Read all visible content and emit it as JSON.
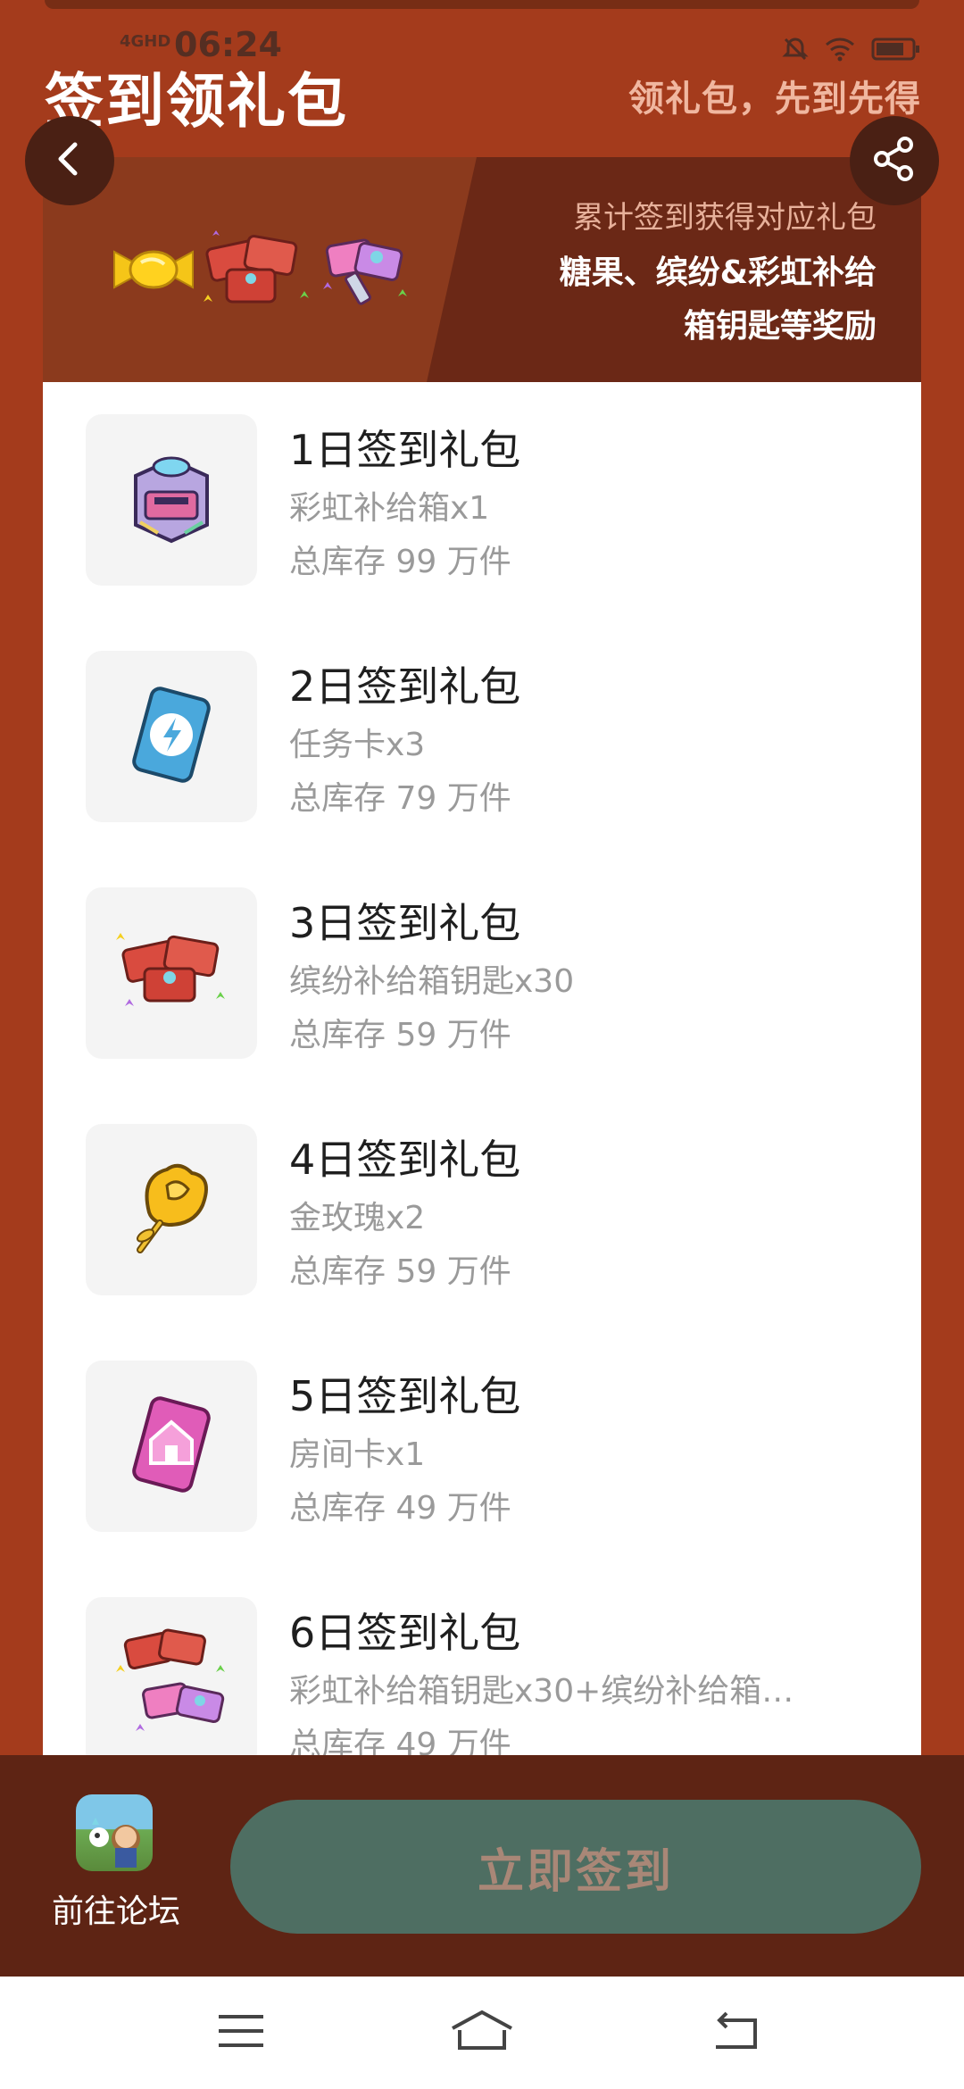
{
  "status_bar": {
    "time": "06:24",
    "network": "4GHD"
  },
  "header": {
    "title": "签到领礼包",
    "slogan": "领礼包，先到先得"
  },
  "banner": {
    "line1": "累计签到获得对应礼包",
    "line2": "糖果、缤纷&彩虹补给",
    "line3": "箱钥匙等奖励"
  },
  "gifts": [
    {
      "title": "1日签到礼包",
      "content": "彩虹补给箱x1",
      "stock": "总库存 99 万件",
      "icon": "rainbow-supply-box-icon"
    },
    {
      "title": "2日签到礼包",
      "content": "任务卡x3",
      "stock": "总库存 79 万件",
      "icon": "task-card-icon"
    },
    {
      "title": "3日签到礼包",
      "content": "缤纷补给箱钥匙x30",
      "stock": "总库存 59 万件",
      "icon": "colorful-key-icon"
    },
    {
      "title": "4日签到礼包",
      "content": "金玫瑰x2",
      "stock": "总库存 59 万件",
      "icon": "gold-rose-icon"
    },
    {
      "title": "5日签到礼包",
      "content": "房间卡x1",
      "stock": "总库存 49 万件",
      "icon": "room-card-icon"
    },
    {
      "title": "6日签到礼包",
      "content": "彩虹补给箱钥匙x30+缤纷补给箱…",
      "stock": "总库存 49 万件",
      "icon": "key-bundle-icon"
    }
  ],
  "bottom": {
    "forum_label": "前往论坛",
    "checkin_label": "立即签到"
  },
  "colors": {
    "background": "#A43B1C",
    "banner_dark": "#6B2816",
    "bottom_bar": "#5E2414",
    "button": "#4E6E62"
  }
}
